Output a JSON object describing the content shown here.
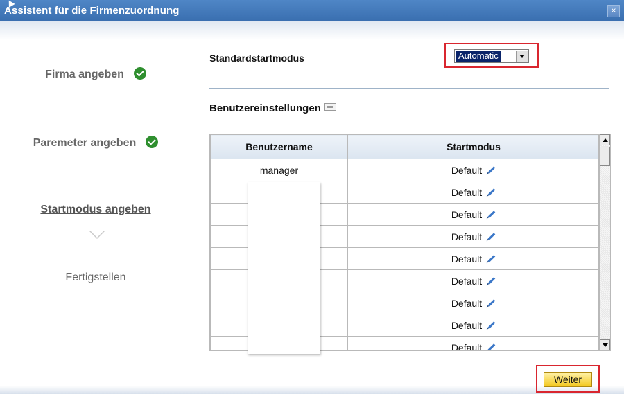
{
  "window": {
    "title": "Assistent für die Firmenzuordnung",
    "close_glyph": "×"
  },
  "steps": [
    {
      "label": "Firma angeben",
      "status": "done"
    },
    {
      "label": "Paremeter angeben",
      "status": "done"
    },
    {
      "label": "Startmodus angeben",
      "status": "current"
    },
    {
      "label": "Fertigstellen",
      "status": "future"
    }
  ],
  "form": {
    "default_mode_label": "Standardstartmodus",
    "default_mode_value": "Automatic",
    "user_settings_label": "Benutzereinstellungen"
  },
  "table": {
    "columns": [
      "Benutzername",
      "Startmodus"
    ],
    "rows": [
      {
        "user": "manager",
        "mode": "Default"
      },
      {
        "user": "",
        "mode": "Default"
      },
      {
        "user": "",
        "mode": "Default"
      },
      {
        "user": "",
        "mode": "Default"
      },
      {
        "user": "",
        "mode": "Default"
      },
      {
        "user": "",
        "mode": "Default"
      },
      {
        "user": "",
        "mode": "Default"
      },
      {
        "user": "",
        "mode": "Default"
      },
      {
        "user": "",
        "mode": "Default"
      }
    ]
  },
  "footer": {
    "next_label": "Weiter"
  },
  "colors": {
    "titlebar": "#3a6fb0",
    "check": "#2f8f2f",
    "highlight_border": "#d9262f",
    "button": "#f3c81f"
  }
}
